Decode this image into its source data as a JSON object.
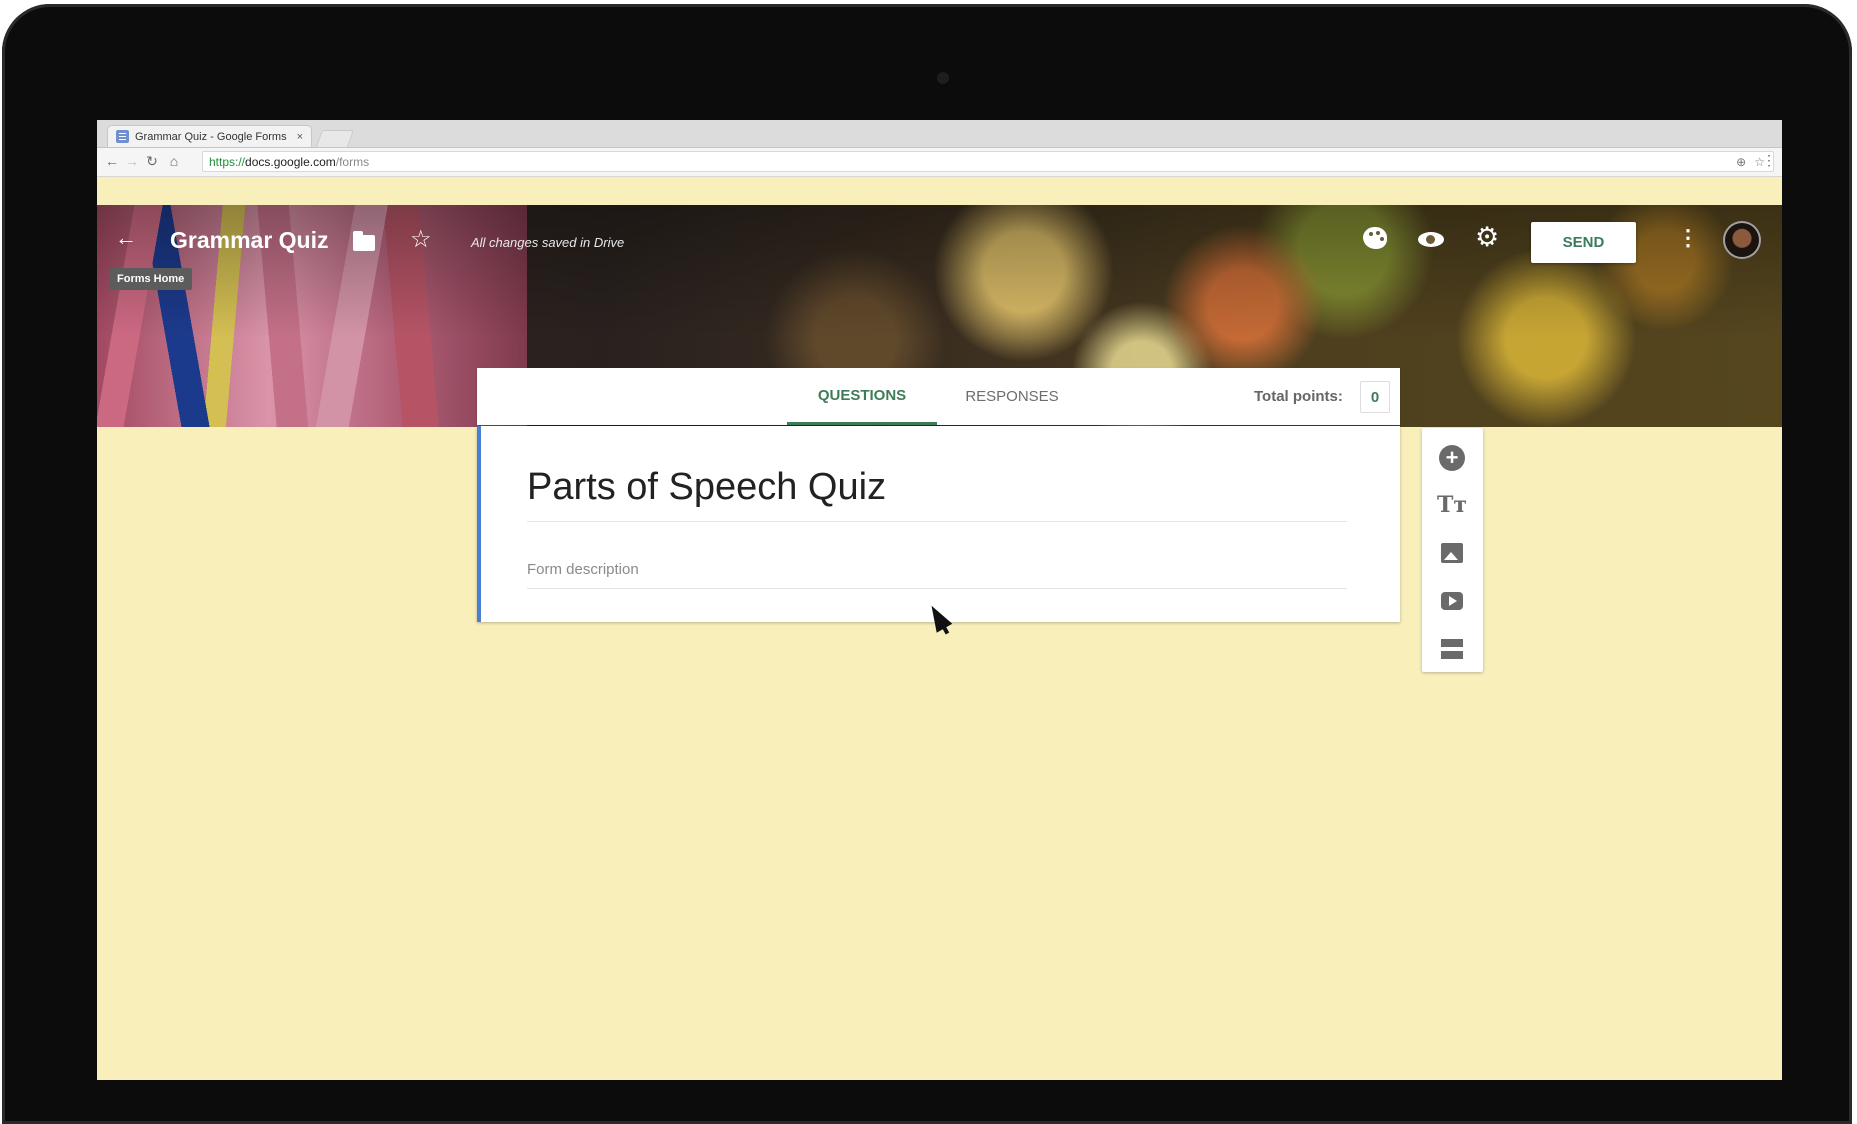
{
  "browser": {
    "tab_title": "Grammar Quiz - Google Forms",
    "tab_close": "×",
    "url_scheme": "https://",
    "url_host": "docs.google.com",
    "url_path": "/forms"
  },
  "header": {
    "title": "Grammar Quiz",
    "saved_status": "All changes saved in Drive",
    "tooltip": "Forms Home",
    "send_label": "SEND"
  },
  "tabs": {
    "questions": "QUESTIONS",
    "responses": "RESPONSES",
    "total_label": "Total points:",
    "total_value": "0"
  },
  "form": {
    "title": "Parts of Speech Quiz",
    "description_placeholder": "Form description"
  },
  "colors": {
    "accent_green": "#3e7c57",
    "card_border_blue": "#4b7fd6",
    "page_background": "#f8efbb"
  },
  "icons": [
    "back-arrow-icon",
    "folder-icon",
    "star-icon",
    "palette-icon",
    "eye-icon",
    "gear-icon",
    "more-vert-icon",
    "add-question-icon",
    "title-text-icon",
    "image-icon",
    "video-icon",
    "section-icon"
  ]
}
